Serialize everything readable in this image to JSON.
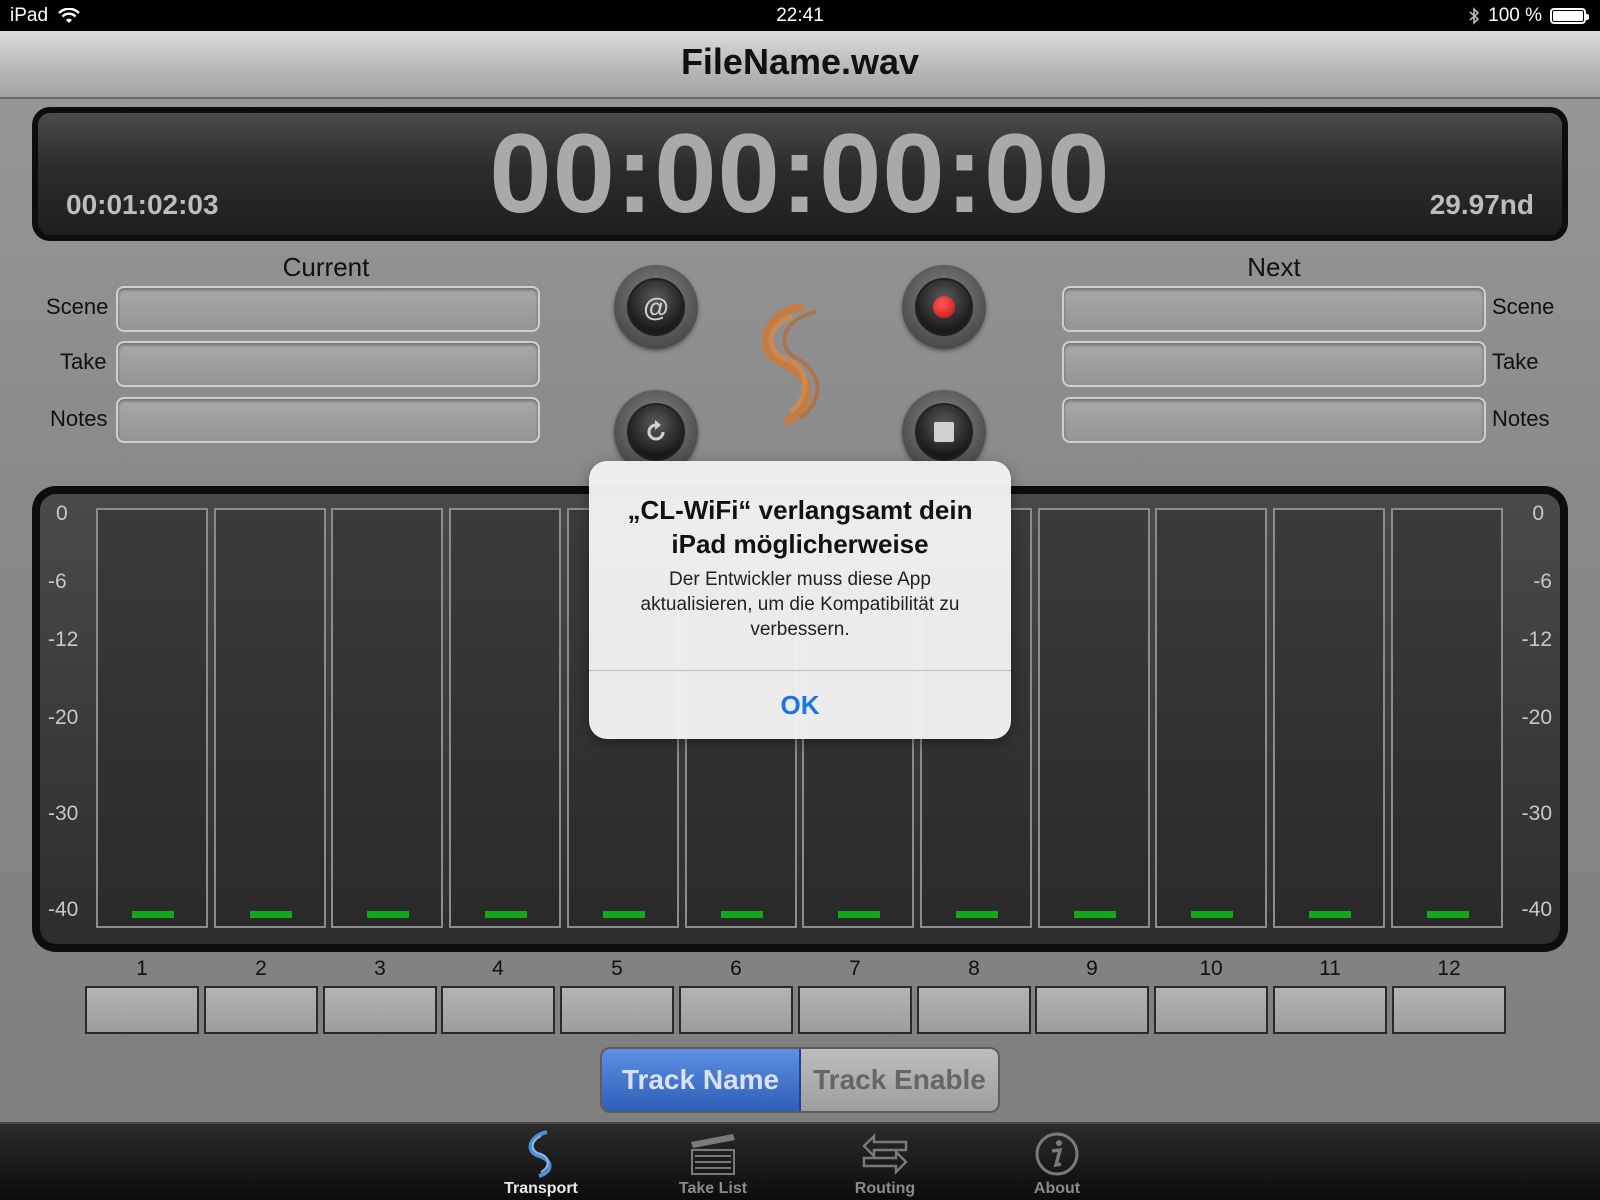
{
  "status_bar": {
    "device": "iPad",
    "time": "22:41",
    "battery": "100 %"
  },
  "title": "FileName.wav",
  "timecode": {
    "main": "00:00:00:00",
    "elapsed": "00:01:02:03",
    "frame_rate": "29.97nd"
  },
  "current": {
    "heading": "Current",
    "labels": {
      "scene": "Scene",
      "take": "Take",
      "notes": "Notes"
    }
  },
  "next": {
    "heading": "Next",
    "labels": {
      "scene": "Scene",
      "take": "Take",
      "notes": "Notes"
    }
  },
  "transport_buttons": {
    "at": "@",
    "loop_icon": "refresh-icon",
    "record_icon": "record-icon",
    "stop_icon": "stop-icon",
    "record_color": "#d81313"
  },
  "meter_scale": [
    "0",
    "-6",
    "-12",
    "-20",
    "-30",
    "-40"
  ],
  "tracks": [
    "1",
    "2",
    "3",
    "4",
    "5",
    "6",
    "7",
    "8",
    "9",
    "10",
    "11",
    "12"
  ],
  "segment": {
    "track_name": "Track Name",
    "track_enable": "Track Enable"
  },
  "tabs": [
    {
      "label": "Transport",
      "icon": "transport-logo-icon",
      "active": true
    },
    {
      "label": "Take List",
      "icon": "clapperboard-icon",
      "active": false
    },
    {
      "label": "Routing",
      "icon": "routing-arrows-icon",
      "active": false
    },
    {
      "label": "About",
      "icon": "info-icon",
      "active": false
    }
  ],
  "alert": {
    "title": "„CL-WiFi“ verlangsamt dein iPad möglicherweise",
    "message": "Der Entwickler muss diese App aktualisieren, um die Kompatibilität zu verbessern.",
    "ok": "OK"
  },
  "colors": {
    "accent_blue": "#2e5fb8",
    "meter_green": "#13a81b",
    "logo_orange": "#c97a3e",
    "ok_blue": "#1a73e8"
  }
}
